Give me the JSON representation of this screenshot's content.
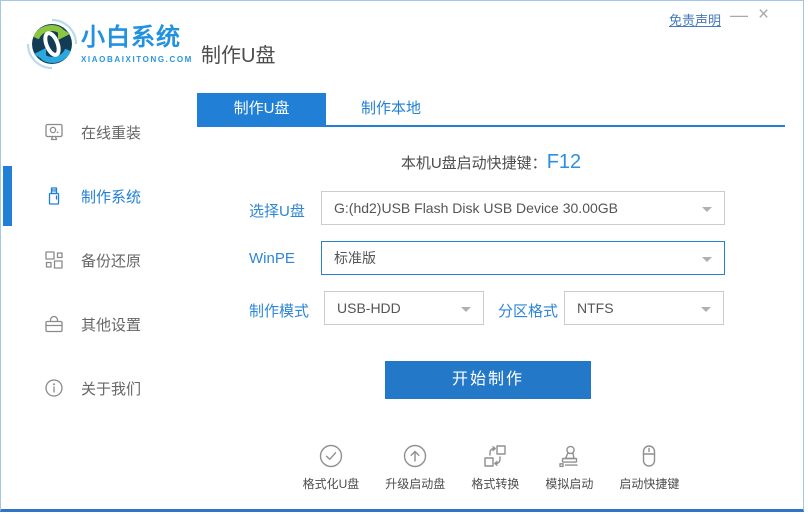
{
  "titlebar": {
    "disclaimer": "免责声明",
    "minimize": "—",
    "close": "×"
  },
  "header": {
    "logo_title": "小白系统",
    "logo_subtitle": "XIAOBAIXITONG.COM",
    "page_title": "制作U盘"
  },
  "sidebar": {
    "items": [
      {
        "label": "在线重装",
        "icon": "monitor-icon",
        "active": false
      },
      {
        "label": "制作系统",
        "icon": "usb-drive-icon",
        "active": true
      },
      {
        "label": "备份还原",
        "icon": "backup-restore-icon",
        "active": false
      },
      {
        "label": "其他设置",
        "icon": "toolbox-icon",
        "active": false
      },
      {
        "label": "关于我们",
        "icon": "info-icon",
        "active": false
      }
    ]
  },
  "tabs": [
    {
      "label": "制作U盘",
      "active": true
    },
    {
      "label": "制作本地",
      "active": false
    }
  ],
  "content": {
    "hotkey_label": "本机U盘启动快捷键：",
    "hotkey_value": "F12",
    "fields": {
      "usb": {
        "label": "选择U盘",
        "value": "G:(hd2)USB Flash Disk USB Device 30.00GB"
      },
      "winpe": {
        "label": "WinPE",
        "value": "标准版"
      },
      "mode": {
        "label": "制作模式",
        "value": "USB-HDD"
      },
      "partition": {
        "label": "分区格式",
        "value": "NTFS"
      }
    },
    "start_button": "开始制作"
  },
  "footer": {
    "tools": [
      {
        "label": "格式化U盘",
        "icon": "check-circle-icon"
      },
      {
        "label": "升级启动盘",
        "icon": "upload-circle-icon"
      },
      {
        "label": "格式转换",
        "icon": "format-convert-icon"
      },
      {
        "label": "模拟启动",
        "icon": "stamp-icon"
      },
      {
        "label": "启动快捷键",
        "icon": "mouse-icon"
      }
    ]
  },
  "colors": {
    "primary_blue": "#2180D6",
    "button_blue": "#2478C8",
    "logo_blue": "#2191E0",
    "link_blue": "#4479BB",
    "label_blue": "#2E86D8",
    "hotkey_blue": "#2D8FE0",
    "text_dark": "#4D4D4D",
    "text_gray": "#666666",
    "icon_gray": "#8F8F8F",
    "border_gray": "#CCCCCC",
    "window_border": "#A5C6E5",
    "window_bottom_border": "#3075C5"
  }
}
